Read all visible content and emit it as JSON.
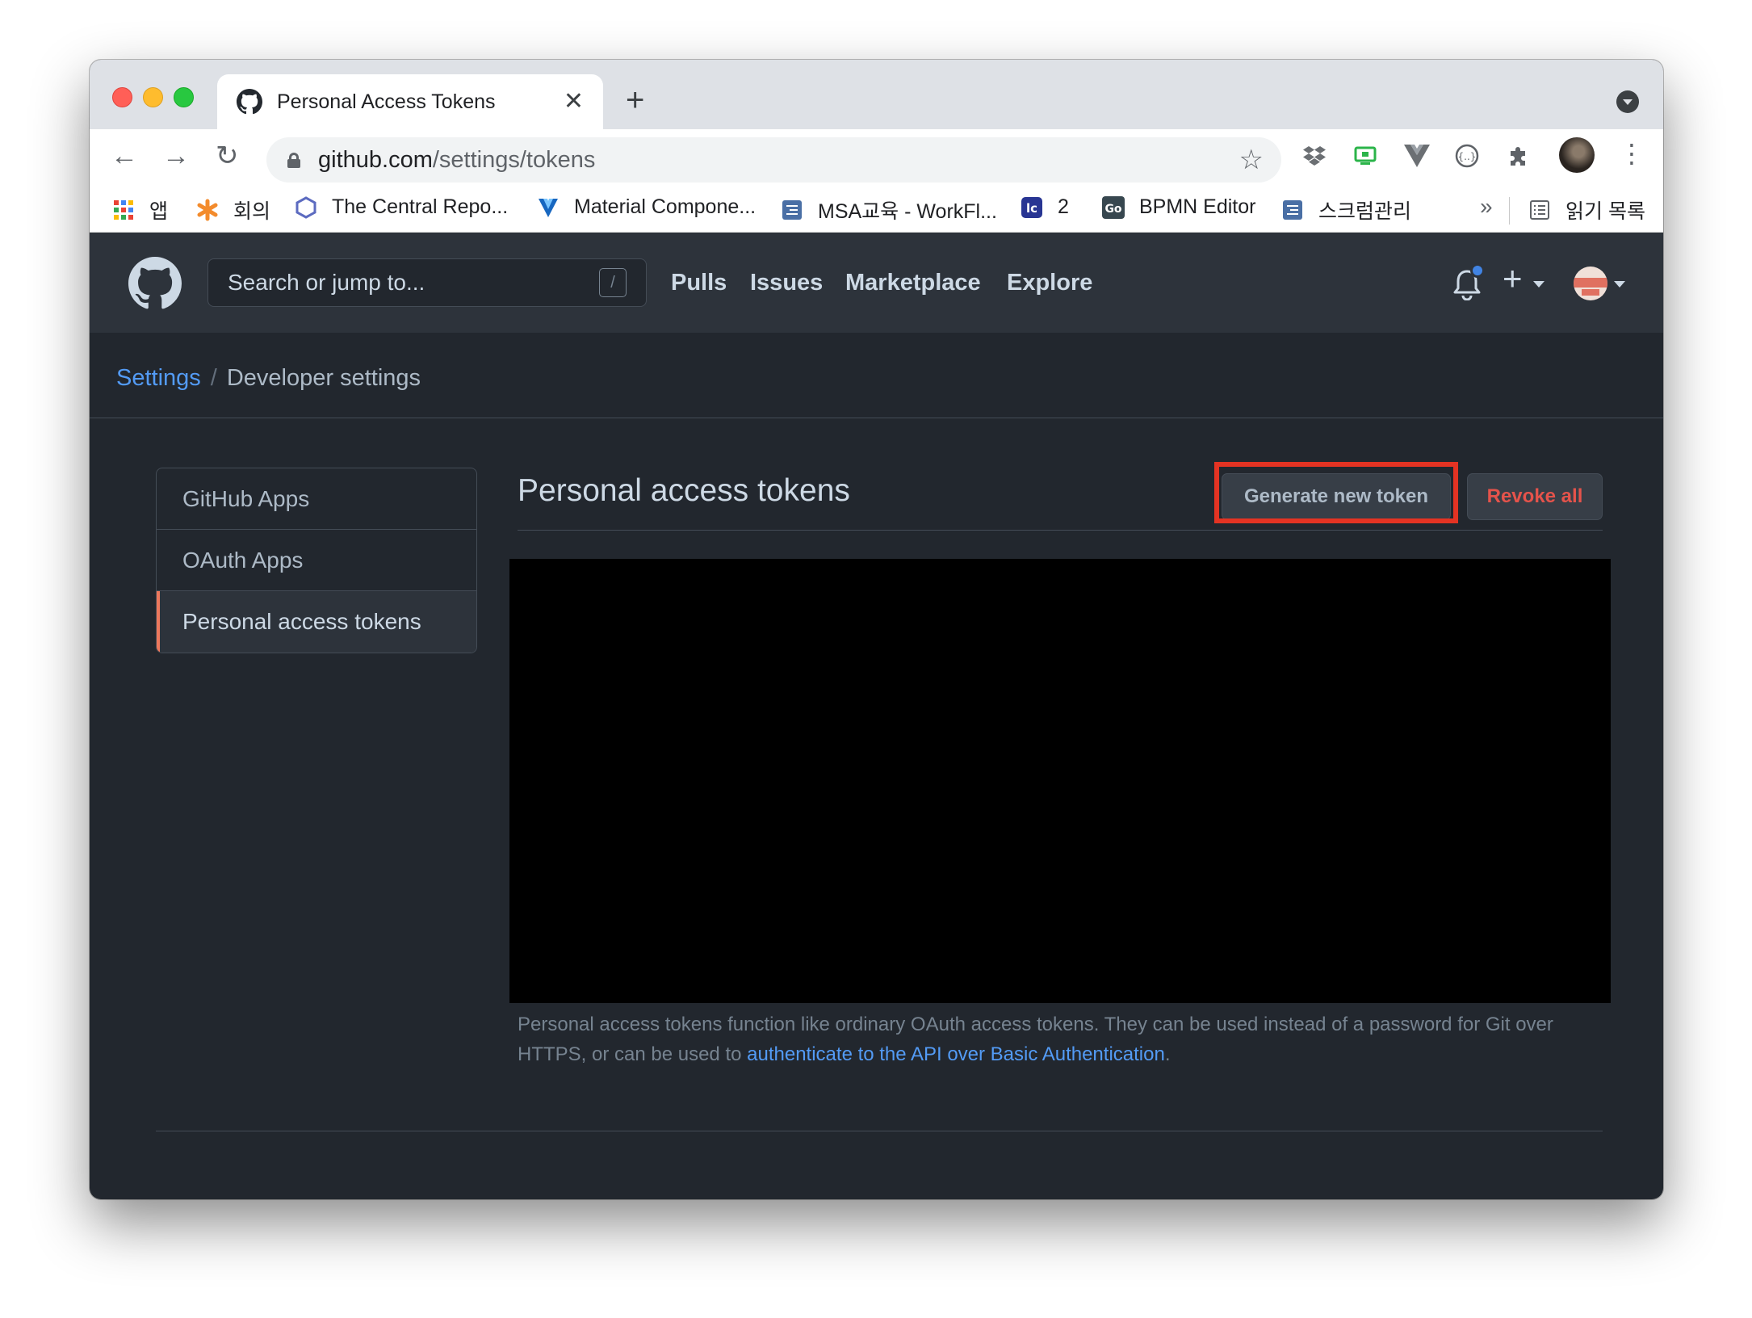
{
  "browser": {
    "tab_title": "Personal Access Tokens",
    "url_host": "github.com",
    "url_path": "/settings/tokens",
    "bookmarks": [
      {
        "label": "앱",
        "icon": "apps-grid-icon"
      },
      {
        "label": "회의",
        "icon": "asterisk-icon"
      },
      {
        "label": "The Central Repo...",
        "icon": "hexagon-icon"
      },
      {
        "label": "Material Compone...",
        "icon": "vuetify-icon"
      },
      {
        "label": "MSA교육 - WorkFl...",
        "icon": "doc-icon"
      },
      {
        "label": "2",
        "icon": "app-icon"
      },
      {
        "label": "BPMN Editor",
        "icon": "go-icon"
      },
      {
        "label": "스크럼관리",
        "icon": "doc-icon"
      }
    ],
    "overflow": "»",
    "reading_list": "읽기 목록"
  },
  "github": {
    "search_placeholder": "Search or jump to...",
    "search_shortcut": "/",
    "nav": [
      "Pulls",
      "Issues",
      "Marketplace",
      "Explore"
    ],
    "breadcrumb": {
      "parent": "Settings",
      "separator": "/",
      "current": "Developer settings"
    },
    "sidebar": [
      "GitHub Apps",
      "OAuth Apps",
      "Personal access tokens"
    ],
    "page_title": "Personal access tokens",
    "generate_button": "Generate new token",
    "revoke_button": "Revoke all",
    "note_text": "Personal access tokens function like ordinary OAuth access tokens. They can be used instead of a password for Git over HTTPS, or can be used to ",
    "note_link": "authenticate to the API over Basic Authentication",
    "note_end": "."
  },
  "colors": {
    "bg": "#22272e",
    "header": "#2d333b",
    "link": "#539bf5",
    "danger": "#e5534b",
    "highlight": "#e43323",
    "active_bar": "#ec775c"
  }
}
